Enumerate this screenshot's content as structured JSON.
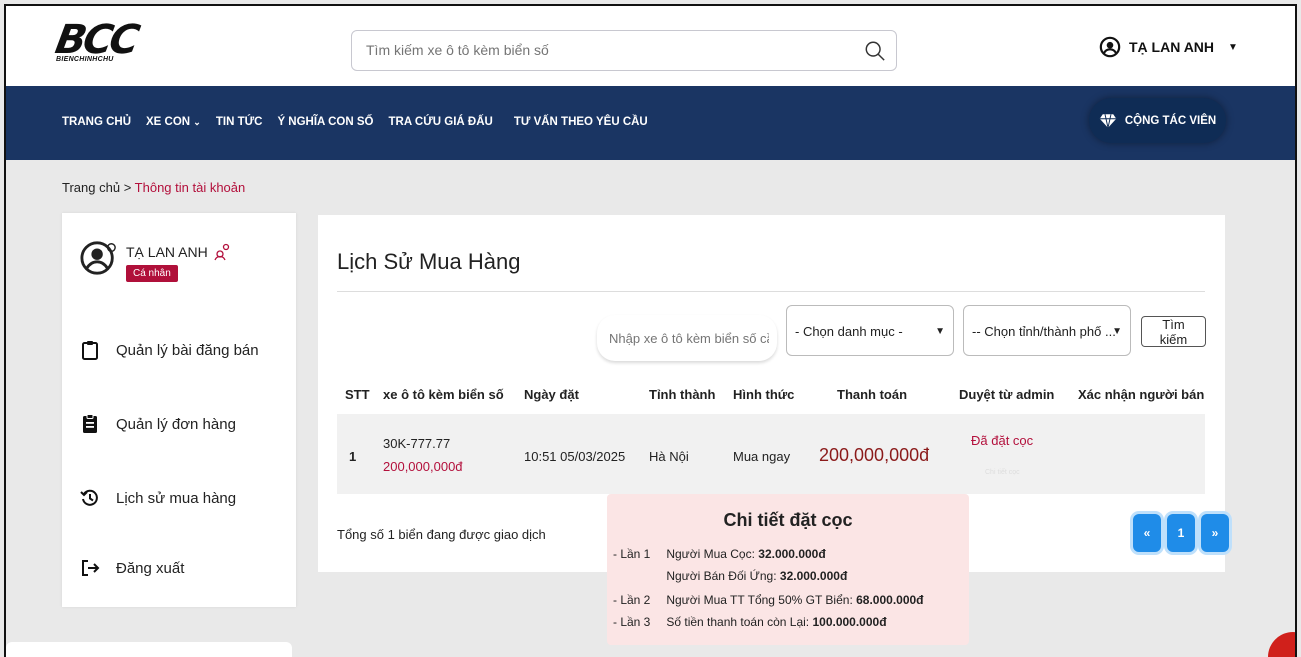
{
  "brand": {
    "logo_text": "BCC",
    "logo_sub": "BIENCHINHCHU"
  },
  "search": {
    "placeholder": "Tìm kiếm xe ô tô kèm biển số"
  },
  "user": {
    "name": "TẠ LAN ANH"
  },
  "nav": {
    "items": [
      "TRANG CHỦ",
      "XE CON",
      "TIN TỨC",
      "Ý NGHĨA CON SỐ",
      "TRA CỨU GIÁ ĐẤU",
      "TƯ VẤN THEO YÊU CẦU"
    ],
    "partner_button": "CỘNG TÁC VIÊN"
  },
  "breadcrumb": {
    "home": "Trang chủ",
    "sep": ">",
    "current": "Thông tin tài khoản"
  },
  "sidebar": {
    "user_name": "TẠ LAN ANH",
    "account_type": "Cá nhân",
    "items": [
      {
        "label": "Quản lý bài đăng bán",
        "icon": "clipboard-icon"
      },
      {
        "label": "Quản lý đơn hàng",
        "icon": "clipboard-list-icon"
      },
      {
        "label": "Lịch sử mua hàng",
        "icon": "history-icon"
      },
      {
        "label": "Đăng xuất",
        "icon": "logout-icon"
      }
    ]
  },
  "main": {
    "title": "Lịch Sử Mua Hàng",
    "filter": {
      "input_placeholder": "Nhập xe ô tô kèm biển số cần tìm",
      "category_selected": "- Chọn danh mục -",
      "province_selected": "-- Chọn tỉnh/thành phố ...",
      "search_button": "Tìm kiếm"
    },
    "table": {
      "columns": [
        "STT",
        "xe ô tô kèm biển số",
        "Ngày đặt",
        "Tỉnh thành",
        "Hình thức",
        "Thanh toán",
        "Duyệt từ admin",
        "Xác nhận người bán"
      ],
      "rows": [
        {
          "stt": "1",
          "plate": "30K-777.77",
          "plate_price": "200,000,000đ",
          "date": "10:51 05/03/2025",
          "province": "Hà Nội",
          "method": "Mua ngay",
          "payment": "200,000,000đ",
          "admin_status": "Đã đặt cọc",
          "admin_detail_link": "Chi tiết cọc",
          "seller_confirm": ""
        }
      ]
    },
    "total_text": "Tổng số 1 biển đang được giao dịch",
    "pagination": {
      "prev": "«",
      "page": "1",
      "next": "»"
    }
  },
  "deposit_popup": {
    "title": "Chi tiết đặt cọc",
    "lines": [
      {
        "prefix": "- Lần 1",
        "label": "Người Mua Cọc:",
        "value": "32.000.000đ"
      },
      {
        "prefix": "",
        "label": "Người Bán Đối Ứng:",
        "value": "32.000.000đ"
      },
      {
        "prefix": "- Lần 2",
        "label": "Người Mua TT Tổng 50% GT Biển:",
        "value": "68.000.000đ"
      },
      {
        "prefix": "- Lần 3",
        "label": "Số tiền thanh toán còn Lại:",
        "value": "100.000.000đ"
      }
    ]
  },
  "colors": {
    "nav_bg": "#1a3563",
    "accent": "#b3103c",
    "pager": "#1f8ce8",
    "popup_bg": "#fbe5e5"
  }
}
